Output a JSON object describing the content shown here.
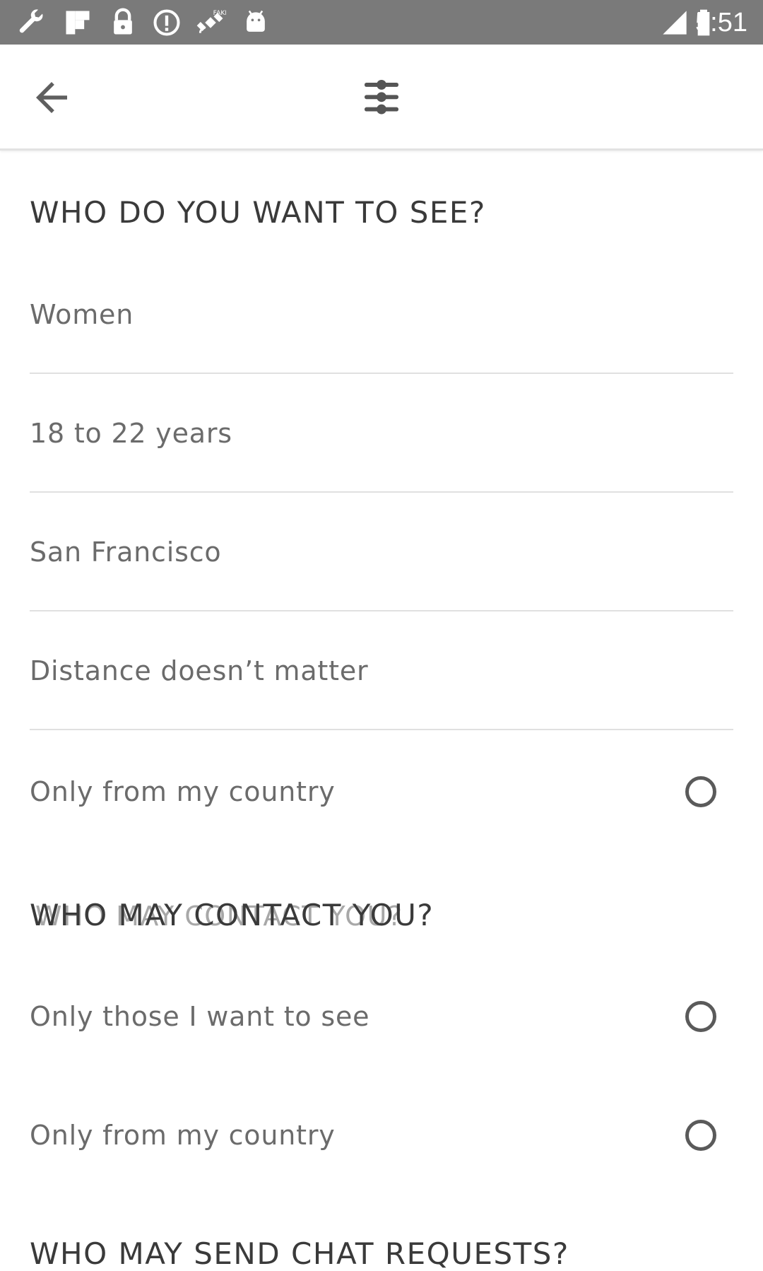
{
  "status_bar": {
    "time": "5:51",
    "left_icons": [
      "wrench-icon",
      "flipboard-icon",
      "lock-icon",
      "circle-alert-icon",
      "fake-gps-satellite-icon",
      "android-icon"
    ],
    "right_icons": [
      "signal-icon",
      "battery-icon"
    ],
    "background": "#7a7a7a"
  },
  "app_bar": {
    "back_icon": "arrow-back-icon",
    "center_icon": "filter-sliders-icon"
  },
  "sections": {
    "see": {
      "heading": "WHO DO YOU WANT TO SEE?",
      "rows": [
        {
          "label": "Women"
        },
        {
          "label": "18 to 22 years"
        },
        {
          "label": "San Francisco"
        },
        {
          "label": "Distance doesn’t matter"
        },
        {
          "label": "Only from my country",
          "radio_selected": false
        }
      ]
    },
    "contact": {
      "heading": "WHO MAY CONTACT YOU?",
      "ghost_heading": "WHO MAY CONTACT YOU?",
      "rows": [
        {
          "label": "Only those I want to see",
          "radio_selected": false
        },
        {
          "label": "Only from my country",
          "radio_selected": false
        }
      ]
    },
    "chat": {
      "heading": "WHO MAY SEND CHAT REQUESTS?"
    }
  },
  "colors": {
    "heading_text": "#3a3a3a",
    "body_text": "#6b6b6b",
    "divider": "#e0e0e0",
    "radio_border": "#5a5a5a"
  }
}
